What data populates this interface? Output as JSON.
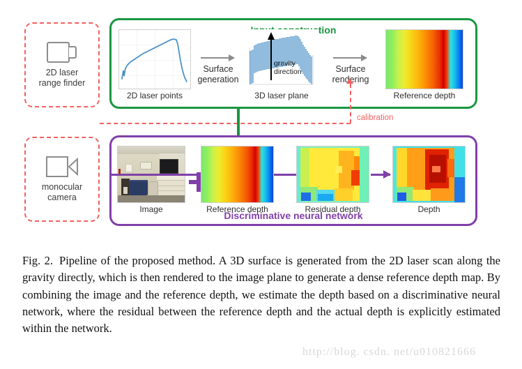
{
  "figure": {
    "sensors": [
      {
        "name": "2d-laser-range-finder",
        "label": "2D laser\nrange finder",
        "icon": "laser-rangefinder-icon"
      },
      {
        "name": "monocular-camera",
        "label": "monocular\ncamera",
        "icon": "video-camera-icon"
      }
    ],
    "input_stage": {
      "title": "Input construction",
      "color": "#1a9641",
      "panels": [
        {
          "caption": "2D laser points"
        },
        {
          "caption": "3D laser plane",
          "annotation": "gravity\ndirection"
        },
        {
          "caption": "Reference depth"
        }
      ],
      "arrows": [
        {
          "label": "Surface\ngeneration"
        },
        {
          "label": "Surface\nrendering"
        }
      ]
    },
    "network_stage": {
      "title": "Discriminative neural network",
      "color": "#8040a8",
      "panels": [
        {
          "caption": "Image"
        },
        {
          "caption": "Reference depth"
        },
        {
          "caption": "Residual depth"
        },
        {
          "caption": "Depth"
        }
      ],
      "plus_symbol": "+"
    },
    "calibration_label": "calibration",
    "calibration_color": "#f0625f"
  },
  "caption": {
    "lead": "Fig. 2.",
    "text": "Pipeline of the proposed method. A 3D surface is generated from the 2D laser scan along the gravity directly, which is then rendered to the image plane to generate a dense reference depth map. By combining the image and the reference depth, we estimate the depth based on a discriminative neural network, where the residual between the reference depth and the actual depth is explicitly estimated within the network."
  },
  "watermark": "http://blog. csdn. net/u010821666"
}
